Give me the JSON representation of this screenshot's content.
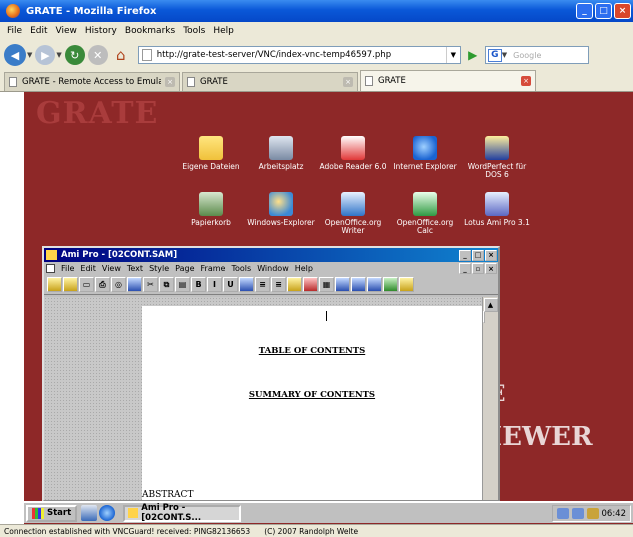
{
  "firefox": {
    "window_title": "GRATE - Mozilla Firefox",
    "menu": [
      "File",
      "Edit",
      "View",
      "History",
      "Bookmarks",
      "Tools",
      "Help"
    ],
    "url": "http://grate-test-server/VNC/index-vnc-temp46597.php",
    "search_placeholder": "Google",
    "tabs": [
      {
        "label": "GRATE - Remote Access to Emulation-..."
      },
      {
        "label": "GRATE"
      },
      {
        "label": "GRATE"
      }
    ],
    "status_left": "Connection established with VNCGuard! received: PING82136653",
    "status_right": "(C) 2007 Randolph Welte"
  },
  "remote": {
    "logo": "GRATE",
    "viewer_text": "IEWER",
    "e_text": "E",
    "icons": [
      {
        "label": "Eigene Dateien"
      },
      {
        "label": "Arbeitsplatz"
      },
      {
        "label": "Adobe Reader 6.0"
      },
      {
        "label": "Internet Explorer"
      },
      {
        "label": "WordPerfect für DOS 6"
      },
      {
        "label": "Papierkorb"
      },
      {
        "label": "Windows-Explorer"
      },
      {
        "label": "OpenOffice.org Writer"
      },
      {
        "label": "OpenOffice.org Calc"
      },
      {
        "label": "Lotus Ami Pro 3.1"
      }
    ]
  },
  "amipro": {
    "title": "Ami Pro - [02CONT.SAM]",
    "menu": [
      "File",
      "Edit",
      "View",
      "Text",
      "Style",
      "Page",
      "Frame",
      "Tools",
      "Window",
      "Help"
    ],
    "doc": {
      "heading1": "TABLE OF CONTENTS",
      "heading2": "SUMMARY OF CONTENTS",
      "abstract": "ABSTRACT"
    }
  },
  "taskbar": {
    "start": "Start",
    "task": "Ami Pro - [02CONT.S...",
    "clock": "06:42"
  }
}
